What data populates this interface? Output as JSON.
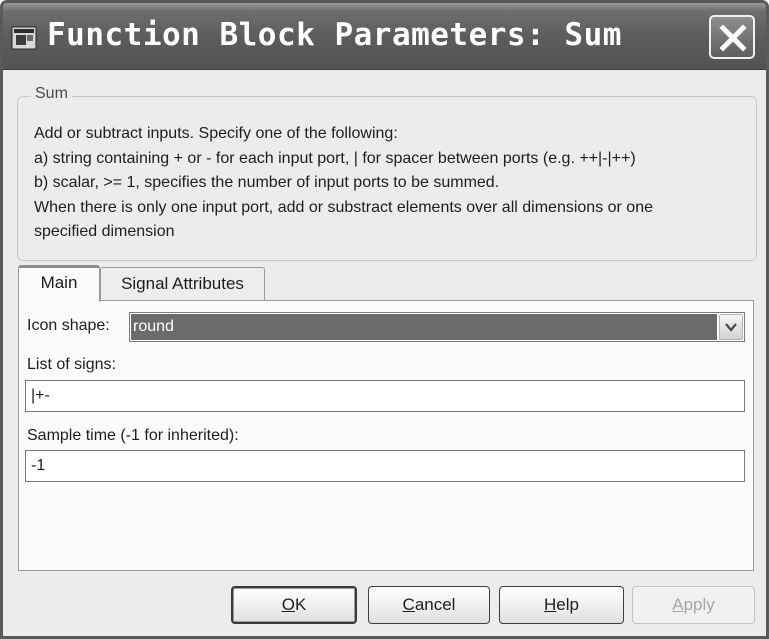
{
  "window": {
    "title": "Function Block Parameters: Sum"
  },
  "group": {
    "label": "Sum",
    "description": [
      "Add or subtract inputs.  Specify one of the following:",
      "a) string containing + or - for each input port, | for spacer between ports (e.g. ++|-|++)",
      "b) scalar, >= 1, specifies the number of input ports to be summed.",
      "When there is only one input port, add or substract elements over all dimensions or one",
      "specified dimension"
    ]
  },
  "tabs": [
    {
      "label": "Main",
      "active": true
    },
    {
      "label": "Signal Attributes",
      "active": false
    }
  ],
  "fields": {
    "icon_shape": {
      "label": "Icon shape:",
      "value": "round"
    },
    "list_of_signs": {
      "label": "List of signs:",
      "value": "|+-"
    },
    "sample_time": {
      "label": "Sample time (-1 for inherited):",
      "value": "-1"
    }
  },
  "buttons": {
    "ok": {
      "mnemonic": "O",
      "rest": "K"
    },
    "cancel": {
      "mnemonic": "C",
      "rest": "ancel"
    },
    "help": {
      "mnemonic": "H",
      "rest": "elp"
    },
    "apply": {
      "mnemonic": "A",
      "rest": "pply",
      "enabled": false
    }
  },
  "icons": {
    "app": "simulink-window-icon",
    "close": "close-icon",
    "dropdown": "chevron-down-icon"
  }
}
